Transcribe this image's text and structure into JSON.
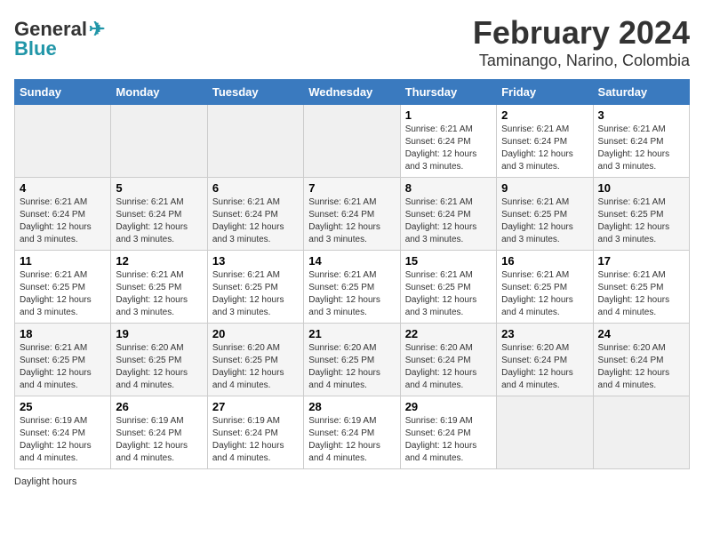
{
  "logo": {
    "line1": "General",
    "line2": "Blue"
  },
  "title": "February 2024",
  "subtitle": "Taminango, Narino, Colombia",
  "days_of_week": [
    "Sunday",
    "Monday",
    "Tuesday",
    "Wednesday",
    "Thursday",
    "Friday",
    "Saturday"
  ],
  "footer": "Daylight hours",
  "weeks": [
    [
      {
        "day": "",
        "info": ""
      },
      {
        "day": "",
        "info": ""
      },
      {
        "day": "",
        "info": ""
      },
      {
        "day": "",
        "info": ""
      },
      {
        "day": "1",
        "info": "Sunrise: 6:21 AM\nSunset: 6:24 PM\nDaylight: 12 hours and 3 minutes."
      },
      {
        "day": "2",
        "info": "Sunrise: 6:21 AM\nSunset: 6:24 PM\nDaylight: 12 hours and 3 minutes."
      },
      {
        "day": "3",
        "info": "Sunrise: 6:21 AM\nSunset: 6:24 PM\nDaylight: 12 hours and 3 minutes."
      }
    ],
    [
      {
        "day": "4",
        "info": "Sunrise: 6:21 AM\nSunset: 6:24 PM\nDaylight: 12 hours and 3 minutes."
      },
      {
        "day": "5",
        "info": "Sunrise: 6:21 AM\nSunset: 6:24 PM\nDaylight: 12 hours and 3 minutes."
      },
      {
        "day": "6",
        "info": "Sunrise: 6:21 AM\nSunset: 6:24 PM\nDaylight: 12 hours and 3 minutes."
      },
      {
        "day": "7",
        "info": "Sunrise: 6:21 AM\nSunset: 6:24 PM\nDaylight: 12 hours and 3 minutes."
      },
      {
        "day": "8",
        "info": "Sunrise: 6:21 AM\nSunset: 6:24 PM\nDaylight: 12 hours and 3 minutes."
      },
      {
        "day": "9",
        "info": "Sunrise: 6:21 AM\nSunset: 6:25 PM\nDaylight: 12 hours and 3 minutes."
      },
      {
        "day": "10",
        "info": "Sunrise: 6:21 AM\nSunset: 6:25 PM\nDaylight: 12 hours and 3 minutes."
      }
    ],
    [
      {
        "day": "11",
        "info": "Sunrise: 6:21 AM\nSunset: 6:25 PM\nDaylight: 12 hours and 3 minutes."
      },
      {
        "day": "12",
        "info": "Sunrise: 6:21 AM\nSunset: 6:25 PM\nDaylight: 12 hours and 3 minutes."
      },
      {
        "day": "13",
        "info": "Sunrise: 6:21 AM\nSunset: 6:25 PM\nDaylight: 12 hours and 3 minutes."
      },
      {
        "day": "14",
        "info": "Sunrise: 6:21 AM\nSunset: 6:25 PM\nDaylight: 12 hours and 3 minutes."
      },
      {
        "day": "15",
        "info": "Sunrise: 6:21 AM\nSunset: 6:25 PM\nDaylight: 12 hours and 3 minutes."
      },
      {
        "day": "16",
        "info": "Sunrise: 6:21 AM\nSunset: 6:25 PM\nDaylight: 12 hours and 4 minutes."
      },
      {
        "day": "17",
        "info": "Sunrise: 6:21 AM\nSunset: 6:25 PM\nDaylight: 12 hours and 4 minutes."
      }
    ],
    [
      {
        "day": "18",
        "info": "Sunrise: 6:21 AM\nSunset: 6:25 PM\nDaylight: 12 hours and 4 minutes."
      },
      {
        "day": "19",
        "info": "Sunrise: 6:20 AM\nSunset: 6:25 PM\nDaylight: 12 hours and 4 minutes."
      },
      {
        "day": "20",
        "info": "Sunrise: 6:20 AM\nSunset: 6:25 PM\nDaylight: 12 hours and 4 minutes."
      },
      {
        "day": "21",
        "info": "Sunrise: 6:20 AM\nSunset: 6:25 PM\nDaylight: 12 hours and 4 minutes."
      },
      {
        "day": "22",
        "info": "Sunrise: 6:20 AM\nSunset: 6:24 PM\nDaylight: 12 hours and 4 minutes."
      },
      {
        "day": "23",
        "info": "Sunrise: 6:20 AM\nSunset: 6:24 PM\nDaylight: 12 hours and 4 minutes."
      },
      {
        "day": "24",
        "info": "Sunrise: 6:20 AM\nSunset: 6:24 PM\nDaylight: 12 hours and 4 minutes."
      }
    ],
    [
      {
        "day": "25",
        "info": "Sunrise: 6:19 AM\nSunset: 6:24 PM\nDaylight: 12 hours and 4 minutes."
      },
      {
        "day": "26",
        "info": "Sunrise: 6:19 AM\nSunset: 6:24 PM\nDaylight: 12 hours and 4 minutes."
      },
      {
        "day": "27",
        "info": "Sunrise: 6:19 AM\nSunset: 6:24 PM\nDaylight: 12 hours and 4 minutes."
      },
      {
        "day": "28",
        "info": "Sunrise: 6:19 AM\nSunset: 6:24 PM\nDaylight: 12 hours and 4 minutes."
      },
      {
        "day": "29",
        "info": "Sunrise: 6:19 AM\nSunset: 6:24 PM\nDaylight: 12 hours and 4 minutes."
      },
      {
        "day": "",
        "info": ""
      },
      {
        "day": "",
        "info": ""
      }
    ]
  ]
}
